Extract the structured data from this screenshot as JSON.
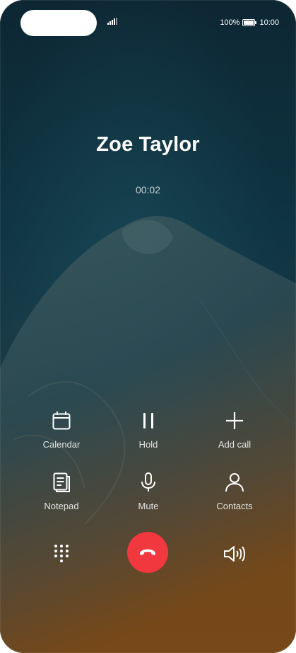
{
  "status_bar": {
    "battery_percent": "100%",
    "time": "10:00"
  },
  "call": {
    "caller_name": "Zoe Taylor",
    "timer": "00:02"
  },
  "actions": [
    {
      "label": "Calendar",
      "icon": "calendar-icon"
    },
    {
      "label": "Hold",
      "icon": "pause-icon"
    },
    {
      "label": "Add call",
      "icon": "plus-icon"
    },
    {
      "label": "Notepad",
      "icon": "notepad-icon"
    },
    {
      "label": "Mute",
      "icon": "microphone-icon"
    },
    {
      "label": "Contacts",
      "icon": "person-icon"
    }
  ],
  "bottom_controls": {
    "keypad_icon": "dialpad-icon",
    "end_call_icon": "end-call-icon",
    "speaker_icon": "speaker-icon"
  },
  "colors": {
    "end_call": "#f0383e",
    "wallpaper_top": "#0e2d3a",
    "wallpaper_bottom": "#5a3a18"
  }
}
